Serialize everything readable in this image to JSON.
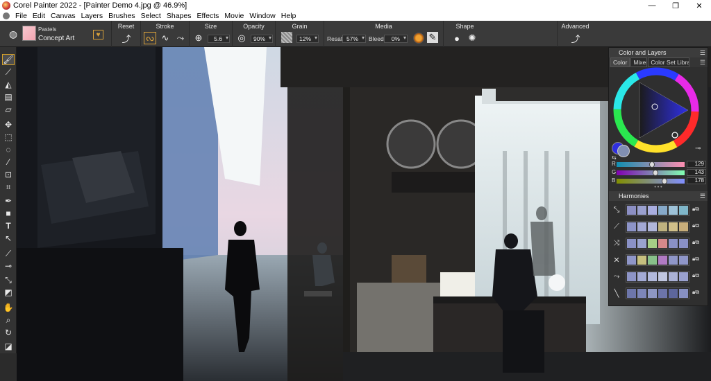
{
  "window": {
    "title": "Corel Painter 2022 - [Painter Demo 4.jpg @ 46.9%]",
    "min": "—",
    "max": "❐",
    "close": "✕"
  },
  "menu": [
    {
      "label": "File"
    },
    {
      "label": "Edit"
    },
    {
      "label": "Canvas"
    },
    {
      "label": "Layers"
    },
    {
      "label": "Brushes"
    },
    {
      "label": "Select"
    },
    {
      "label": "Shapes"
    },
    {
      "label": "Effects"
    },
    {
      "label": "Movie"
    },
    {
      "label": "Window"
    },
    {
      "label": "Help"
    }
  ],
  "propbar": {
    "brush_category": "Pastels",
    "brush_variant": "Concept Art",
    "sections": {
      "reset": "Reset",
      "stroke": "Stroke",
      "size": "Size",
      "opacity": "Opacity",
      "grain": "Grain",
      "media": "Media",
      "shape": "Shape",
      "advanced": "Advanced"
    },
    "size_value": "5.6",
    "opacity_value": "90%",
    "grain_value": "12%",
    "resat_label": "Resat:",
    "resat_value": "57%",
    "bleed_label": "Bleed:",
    "bleed_value": "0%"
  },
  "panel": {
    "title": "Color and Layers",
    "tabs": [
      "Color",
      "Mixer",
      "Color Set Libraries"
    ],
    "rgb": [
      {
        "label": "R",
        "value": "129"
      },
      {
        "label": "G",
        "value": "143"
      },
      {
        "label": "B",
        "value": "178"
      }
    ],
    "harmonies_title": "Harmonies",
    "harmonies": [
      {
        "name": "complementary",
        "colors": [
          "#8c8fc4",
          "#9aa0cf",
          "#a9aee0",
          "#86a9c9",
          "#9dc2d8",
          "#7fb6c9"
        ]
      },
      {
        "name": "analogous",
        "colors": [
          "#8d94c8",
          "#a2a8d4",
          "#b0b6da",
          "#bfb27f",
          "#d1c08a",
          "#c7ad7a"
        ]
      },
      {
        "name": "triadic",
        "colors": [
          "#8a91c6",
          "#9aa3cf",
          "#a6cf86",
          "#d6888a",
          "#8a91c6",
          "#8a91c6"
        ]
      },
      {
        "name": "tetradic",
        "colors": [
          "#8f96c8",
          "#c6c07f",
          "#88c08a",
          "#b07ac3",
          "#8f96c8",
          "#8f96c8"
        ]
      },
      {
        "name": "split",
        "colors": [
          "#8d94c6",
          "#a3aad4",
          "#b2b9dc",
          "#c0c6e0",
          "#aab1d6",
          "#9aa1cf"
        ]
      },
      {
        "name": "monochrome",
        "colors": [
          "#6d76aa",
          "#7d86b8",
          "#8e97c3",
          "#6c74a9",
          "#5d669c",
          "#8790c2"
        ]
      }
    ],
    "current_color": "#818fb2",
    "secondary_color": "#2f2fe0"
  }
}
